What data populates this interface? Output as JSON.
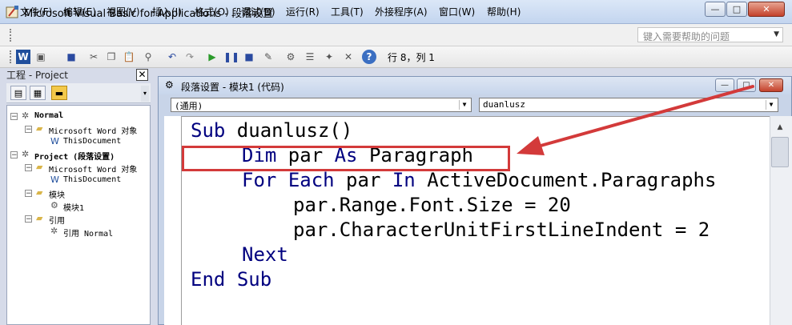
{
  "window": {
    "title": "Microsoft Visual Basic for Applications - 段落设置",
    "min_label": "—",
    "max_label": "□",
    "close_label": "✕"
  },
  "menu": {
    "items": [
      "文件(F)",
      "编辑(E)",
      "视图(V)",
      "插入(I)",
      "格式(O)",
      "调试(D)",
      "运行(R)",
      "工具(T)",
      "外接程序(A)",
      "窗口(W)",
      "帮助(H)"
    ],
    "help_placeholder": "键入需要帮助的问题"
  },
  "toolbar": {
    "status": "行 8，列 1",
    "icons": [
      "word-icon",
      "insert-icon",
      "save-icon",
      "cut-icon",
      "copy-icon",
      "paste-icon",
      "find-icon",
      "undo-icon",
      "redo-icon",
      "run-icon",
      "break-icon",
      "reset-icon",
      "design-mode-icon",
      "project-explorer-icon",
      "properties-icon",
      "object-browser-icon",
      "toolbox-icon",
      "help-icon"
    ]
  },
  "project_panel": {
    "title": "工程 - Project",
    "close_label": "✕",
    "tree": [
      {
        "label": "Normal",
        "level": 0,
        "expander": "−",
        "icon": "vba-project-icon",
        "bold": true
      },
      {
        "label": "Microsoft Word 对象",
        "level": 1,
        "expander": "−",
        "icon": "folder-icon",
        "bold": false
      },
      {
        "label": "ThisDocument",
        "level": 2,
        "expander": "",
        "icon": "word-doc-icon",
        "bold": false
      },
      {
        "label": "Project (段落设置)",
        "level": 0,
        "expander": "−",
        "icon": "vba-project-icon",
        "bold": true
      },
      {
        "label": "Microsoft Word 对象",
        "level": 1,
        "expander": "−",
        "icon": "folder-icon",
        "bold": false
      },
      {
        "label": "ThisDocument",
        "level": 2,
        "expander": "",
        "icon": "word-doc-icon",
        "bold": false
      },
      {
        "label": "模块",
        "level": 1,
        "expander": "−",
        "icon": "folder-icon",
        "bold": false
      },
      {
        "label": "模块1",
        "level": 2,
        "expander": "",
        "icon": "module-icon",
        "bold": false
      },
      {
        "label": "引用",
        "level": 1,
        "expander": "−",
        "icon": "folder-icon",
        "bold": false
      },
      {
        "label": "引用 Normal",
        "level": 2,
        "expander": "",
        "icon": "reference-icon",
        "bold": false
      }
    ]
  },
  "code_window": {
    "title": "段落设置 - 模块1 (代码)",
    "object_combo": "(通用)",
    "proc_combo": "duanlusz",
    "lines": [
      {
        "indent": 0,
        "tokens": [
          {
            "t": "Sub",
            "kw": true
          },
          {
            "t": " duanlusz()",
            "kw": false
          }
        ]
      },
      {
        "indent": 1,
        "tokens": [
          {
            "t": "Dim",
            "kw": true
          },
          {
            "t": " par ",
            "kw": false
          },
          {
            "t": "As",
            "kw": true
          },
          {
            "t": " Paragraph",
            "kw": false
          }
        ]
      },
      {
        "indent": 1,
        "tokens": [
          {
            "t": "For",
            "kw": true
          },
          {
            "t": " ",
            "kw": false
          },
          {
            "t": "Each",
            "kw": true
          },
          {
            "t": " par ",
            "kw": false
          },
          {
            "t": "In",
            "kw": true
          },
          {
            "t": " ActiveDocument.Paragraphs",
            "kw": false
          }
        ]
      },
      {
        "indent": 2,
        "tokens": [
          {
            "t": "par.Range.Font.Size = 20",
            "kw": false
          }
        ]
      },
      {
        "indent": 2,
        "tokens": [
          {
            "t": "par.CharacterUnitFirstLineIndent = 2",
            "kw": false
          }
        ]
      },
      {
        "indent": 1,
        "tokens": [
          {
            "t": "Next",
            "kw": true
          }
        ]
      },
      {
        "indent": 0,
        "tokens": [
          {
            "t": "End",
            "kw": true
          },
          {
            "t": " ",
            "kw": false
          },
          {
            "t": "Sub",
            "kw": true
          }
        ]
      }
    ],
    "highlight_color": "#d33a3a"
  }
}
